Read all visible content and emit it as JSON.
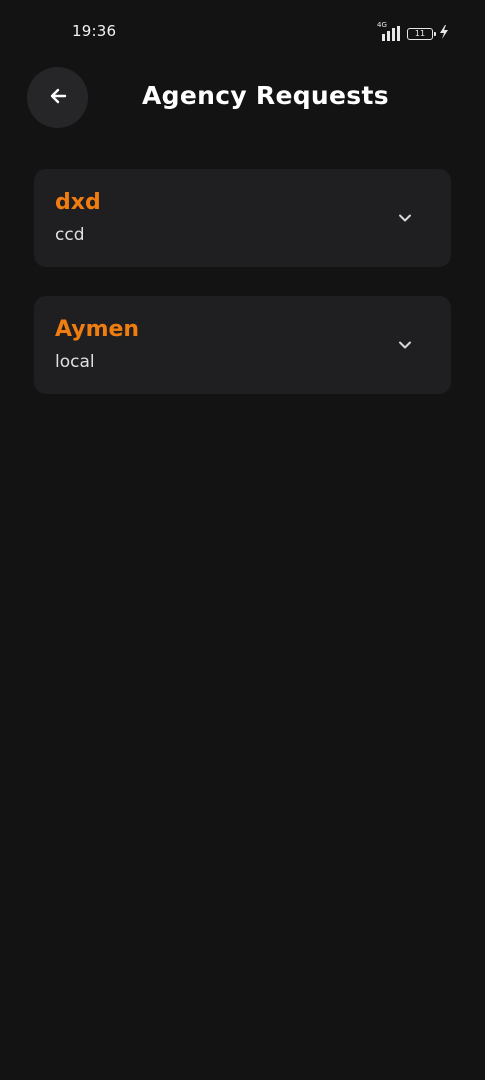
{
  "status_bar": {
    "time": "19:36",
    "network": "4G",
    "battery": "11"
  },
  "header": {
    "title": "Agency Requests"
  },
  "requests": [
    {
      "name": "dxd",
      "location": "ccd"
    },
    {
      "name": "Aymen",
      "location": "local"
    }
  ],
  "colors": {
    "background": "#131314",
    "card": "#1f1e21",
    "accent": "#f07d10"
  },
  "icons": {
    "back": "arrow-left-icon",
    "expand": "chevron-down-icon",
    "signal": "signal-icon",
    "battery": "battery-icon",
    "charging": "lightning-icon"
  }
}
